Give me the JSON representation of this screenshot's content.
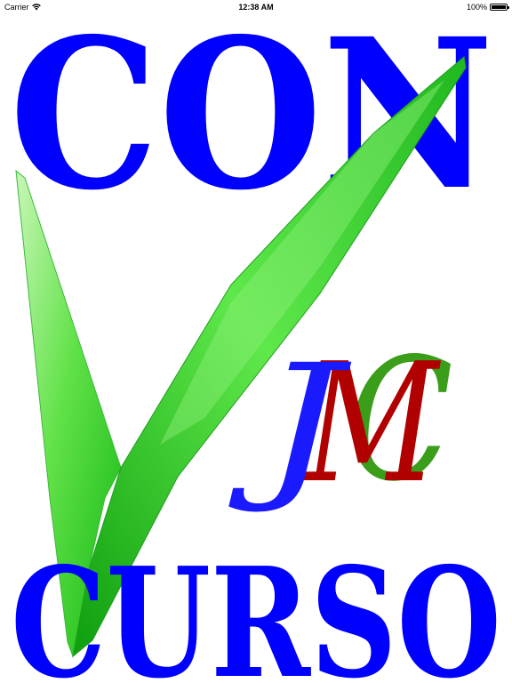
{
  "status_bar": {
    "carrier": "Carrier",
    "time": "12:38 AM",
    "battery": "100%",
    "battery_level": 1.0
  },
  "logo": {
    "top_word": "CON",
    "bottom_word": "CURSO",
    "monogram": {
      "j": "J",
      "m": "M",
      "c": "C"
    }
  },
  "colors": {
    "word_blue": "#0000ff",
    "check_green": "#2ee82e",
    "monogram_j": "#1a1aff",
    "monogram_m": "#b00000",
    "monogram_c": "#3a9e1a"
  }
}
